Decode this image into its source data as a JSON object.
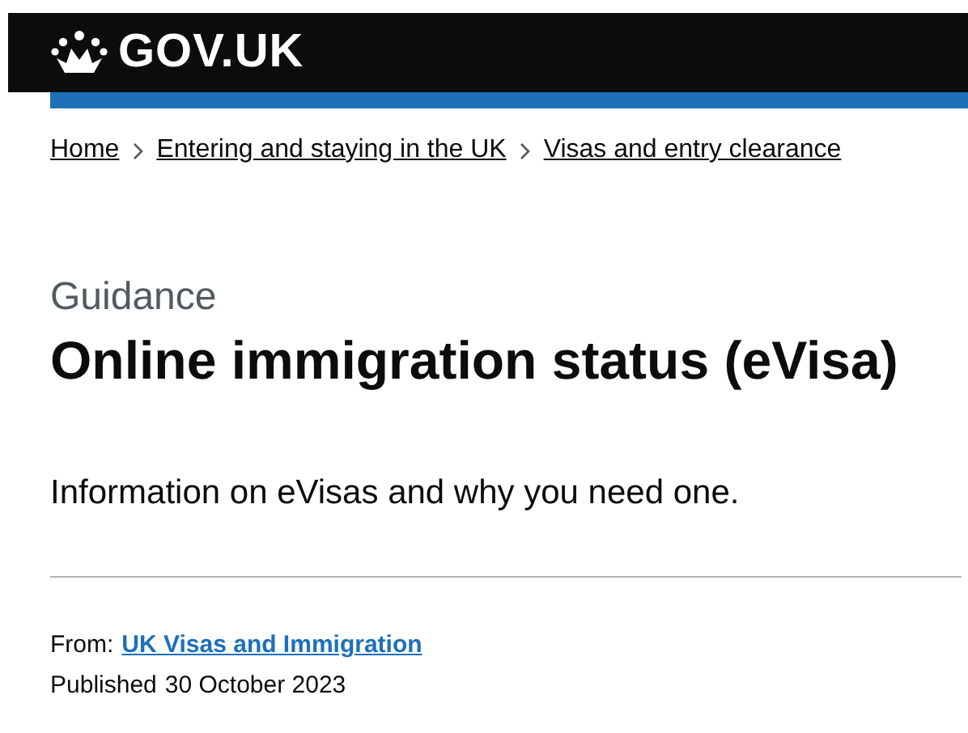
{
  "header": {
    "logo": "GOV.UK"
  },
  "breadcrumbs": [
    {
      "label": "Home"
    },
    {
      "label": "Entering and staying in the UK"
    },
    {
      "label": "Visas and entry clearance"
    }
  ],
  "caption": "Guidance",
  "title": "Online immigration status (eVisa)",
  "lead": "Information on eVisas and why you need one.",
  "metadata": {
    "from_label": "From:",
    "from_link": "UK Visas and Immigration",
    "published_label": "Published",
    "published_date": "30 October 2023"
  }
}
